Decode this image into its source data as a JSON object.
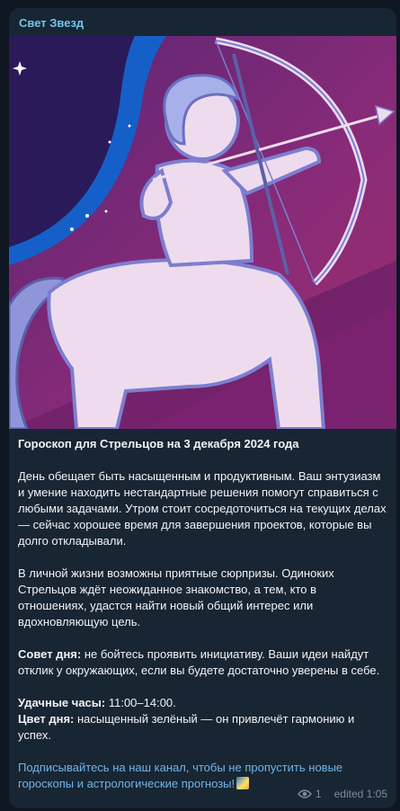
{
  "message": {
    "channel_name": "Свет Звезд",
    "title": "Гороскоп для Стрельцов на 3 декабря 2024 года",
    "paragraph1": "День обещает быть насыщенным и продуктивным. Ваш энтузиазм и умение находить нестандартные решения помогут справиться с любыми задачами. Утром стоит сосредоточиться на текущих делах — сейчас хорошее время для завершения проектов, которые вы долго откладывали.",
    "paragraph2": "В личной жизни возможны приятные сюрпризы. Одиноких Стрельцов ждёт неожиданное знакомство, а тем, кто в отношениях, удастся найти новый общий интерес или вдохновляющую цель.",
    "advice_label": "Совет дня:",
    "advice_text": " не бойтесь проявить инициативу. Ваши идеи найдут отклик у окружающих, если вы будете достаточно уверены в себе.",
    "lucky_hours_label": "Удачные часы:",
    "lucky_hours_value": " 11:00–14:00.",
    "color_label": "Цвет дня:",
    "color_value": " насыщенный зелёный — он привлечёт гармонию и успех.",
    "subscribe_text": "Подписывайтесь на наш канал, чтобы не пропустить новые гороскопы и астрологические прогнозы!",
    "views": "1",
    "edited_time": "edited 1:05"
  },
  "colors": {
    "background": "#0e1621",
    "bubble": "#182533",
    "channel_name": "#71c5ea",
    "link": "#71b4e8",
    "meta": "#7b8b9c"
  }
}
